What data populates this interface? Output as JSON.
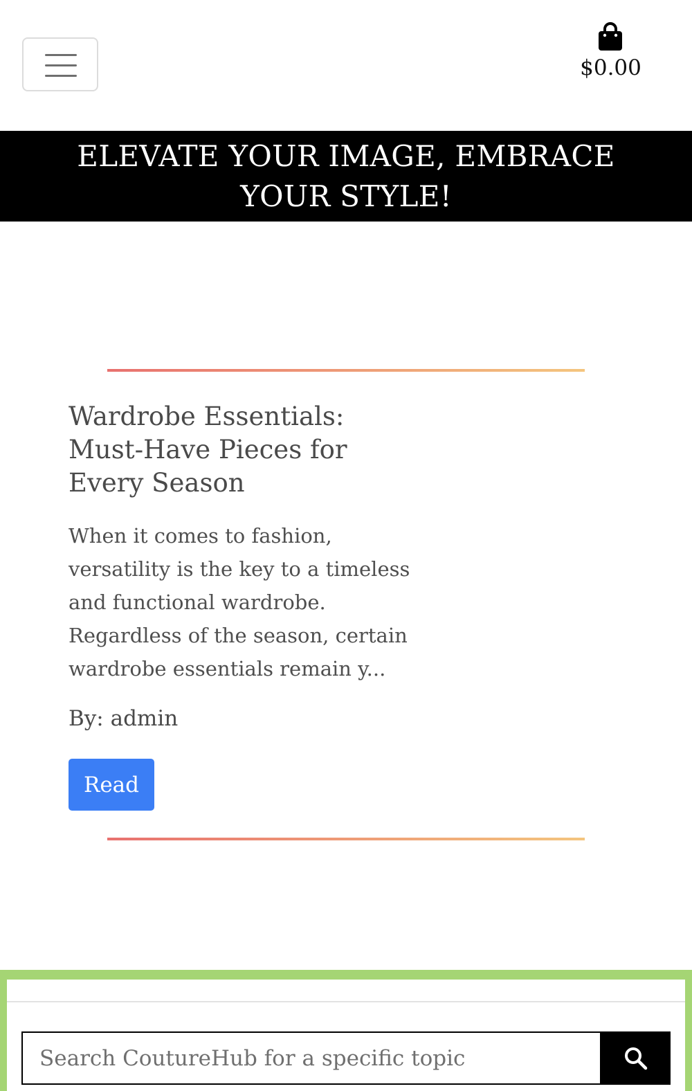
{
  "header": {
    "cart_total": "$0.00"
  },
  "banner": {
    "text": "ELEVATE YOUR IMAGE, EMBRACE YOUR STYLE!"
  },
  "post": {
    "title": "Wardrobe Essentials: Must-Have Pieces for Every Season",
    "excerpt": "When it comes to fashion, versatility is the key to a timeless and functional wardrobe. Regardless of the season, certain wardrobe essentials remain y...",
    "author": "By: admin",
    "read_label": "Read"
  },
  "search": {
    "placeholder": "Search CoutureHub for a specific topic"
  },
  "colors": {
    "banner_bg": "#000000",
    "read_button": "#3b7ef5",
    "divider_start": "#e8716f",
    "divider_end": "#f4c57e",
    "footer_border": "#a5d574"
  }
}
